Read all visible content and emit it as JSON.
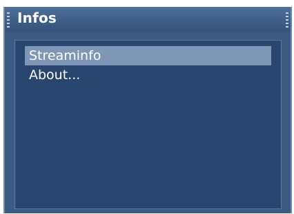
{
  "window": {
    "title": "Infos"
  },
  "menu": {
    "items": [
      {
        "label": "Streaminfo",
        "selected": true
      },
      {
        "label": "About..."
      }
    ]
  },
  "colors": {
    "window_bg": "#3b5a80",
    "content_bg": "#29476e",
    "selection_bg": "#7e97b6",
    "text": "#ffffff"
  }
}
